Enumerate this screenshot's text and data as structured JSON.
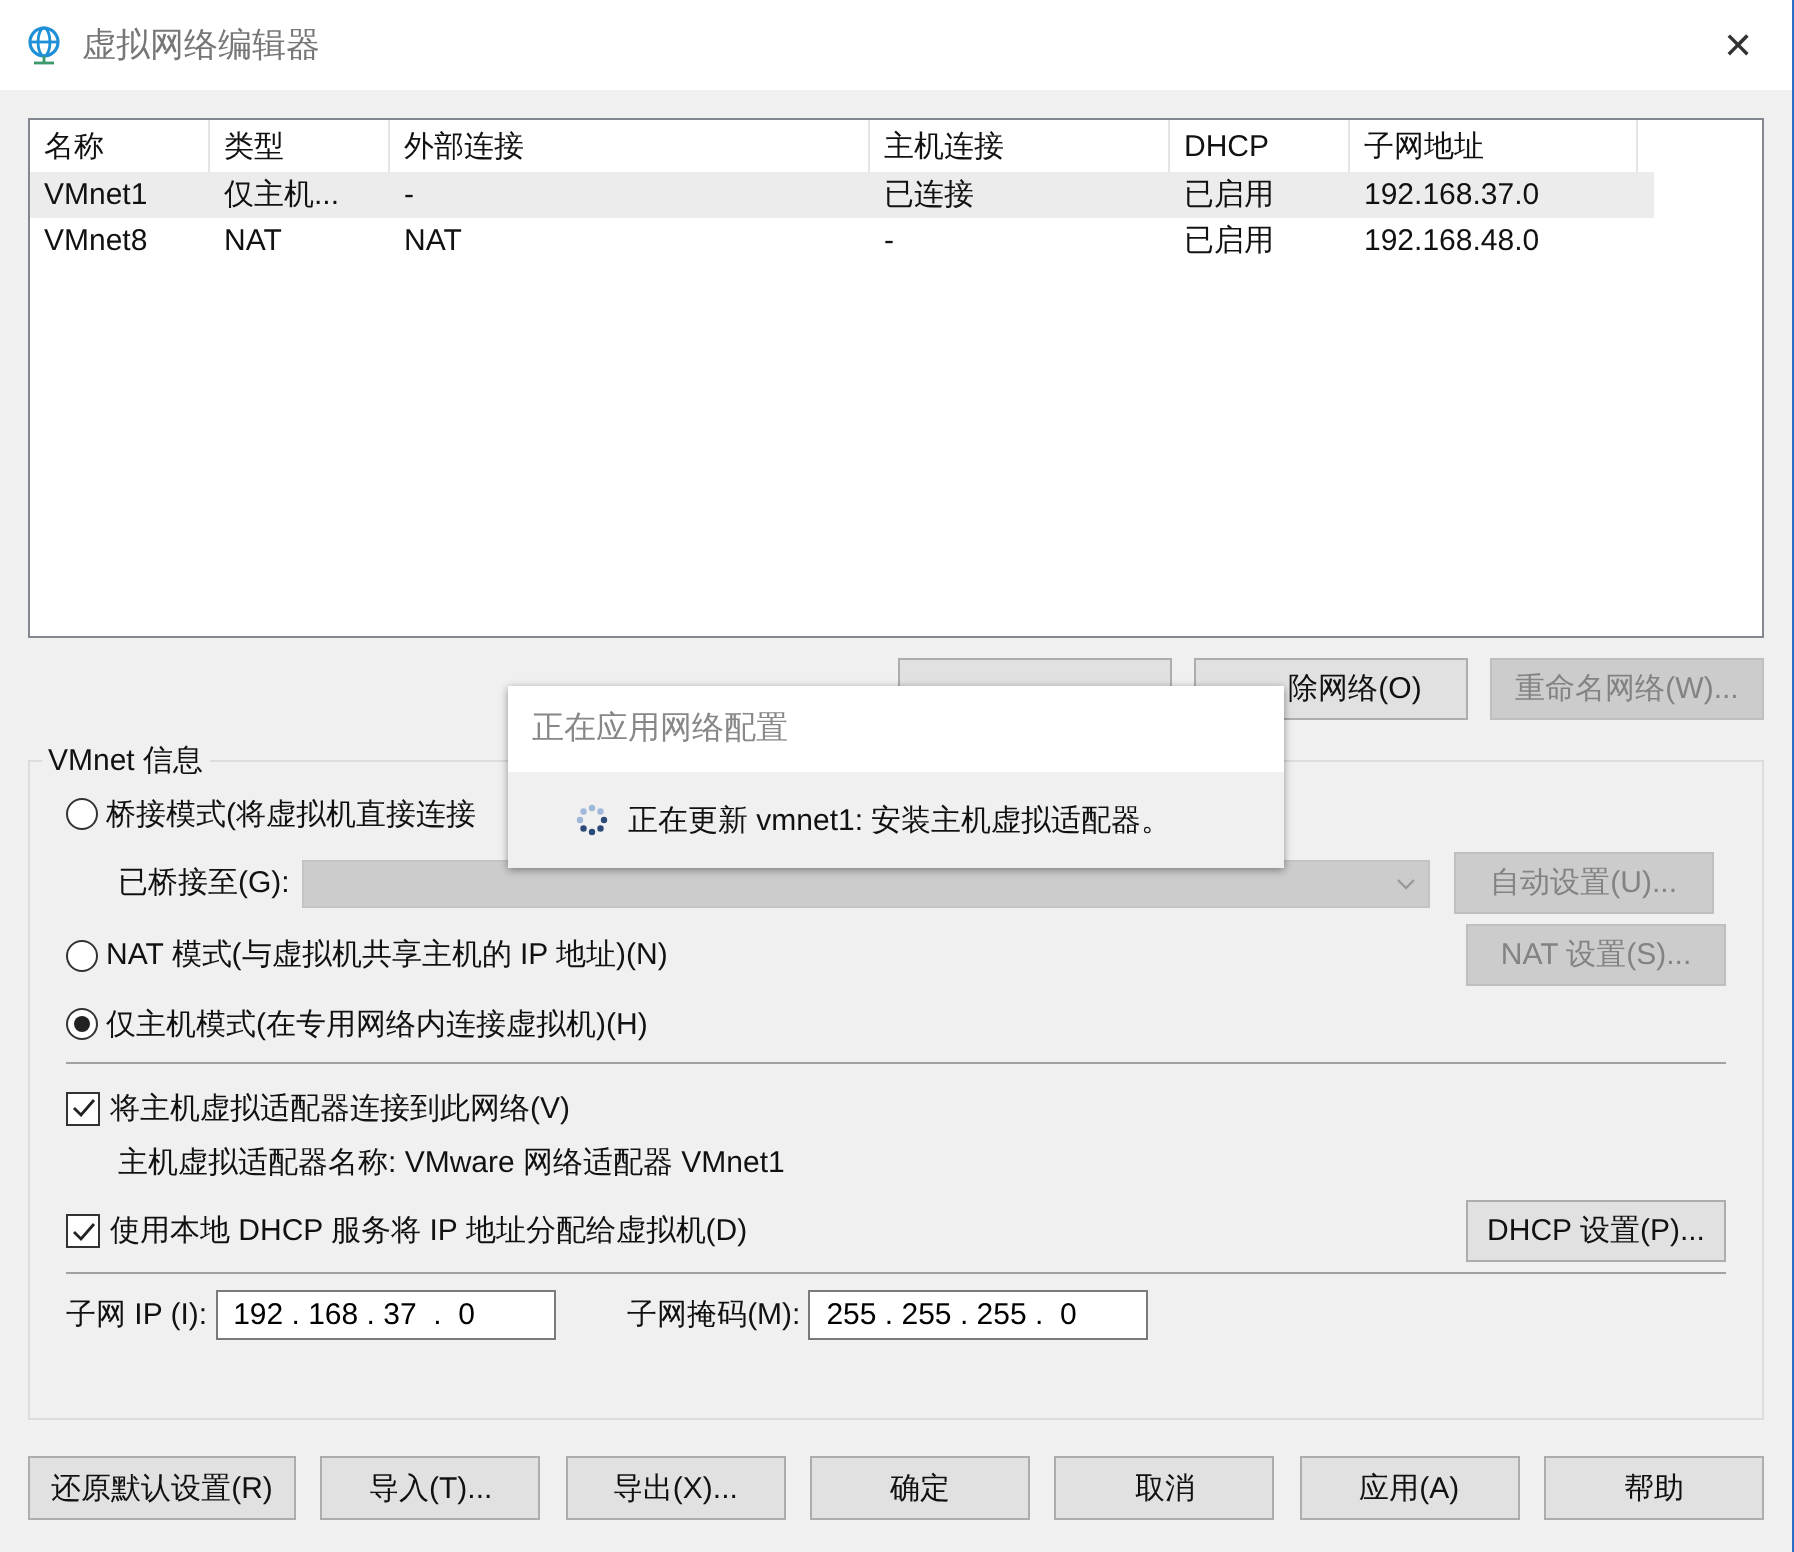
{
  "window": {
    "title": "虚拟网络编辑器",
    "close": "✕"
  },
  "table": {
    "columns": [
      "名称",
      "类型",
      "外部连接",
      "主机连接",
      "DHCP",
      "子网地址"
    ],
    "rows": [
      {
        "cells": [
          "VMnet1",
          "仅主机...",
          "-",
          "已连接",
          "已启用",
          "192.168.37.0"
        ],
        "selected": true
      },
      {
        "cells": [
          "VMnet8",
          "NAT",
          "NAT",
          "-",
          "已启用",
          "192.168.48.0"
        ],
        "selected": false
      }
    ]
  },
  "network_buttons": [
    {
      "disabled": false
    },
    {
      "label": "除网络(O)",
      "disabled": false
    },
    {
      "label": "重命名网络(W)...",
      "disabled": true
    }
  ],
  "group": {
    "title": "VMnet 信息",
    "modes": [
      {
        "label": "桥接模式(将虚拟机直接连接",
        "selected": false
      },
      {
        "label": "NAT 模式(与虚拟机共享主机的 IP 地址)(N)",
        "selected": false
      },
      {
        "label": "仅主机模式(在专用网络内连接虚拟机)(H)",
        "selected": true
      }
    ],
    "bridged_to": {
      "label": "已桥接至(G):",
      "disabled": true
    },
    "auto_button": {
      "label": "自动设置(U)...",
      "disabled": true
    },
    "nat_button": {
      "label": "NAT 设置(S)...",
      "disabled": true
    },
    "connect_adapter": {
      "label": "将主机虚拟适配器连接到此网络(V)",
      "checked": true
    },
    "adapter_name": "主机虚拟适配器名称: VMware 网络适配器 VMnet1",
    "use_dhcp": {
      "label": "使用本地 DHCP 服务将 IP 地址分配给虚拟机(D)",
      "checked": true
    },
    "dhcp_button": {
      "label": "DHCP 设置(P)...",
      "disabled": false
    },
    "subnet_ip": {
      "label": "子网 IP (I):",
      "value": "192 . 168 . 37  .  0"
    },
    "subnet_mask": {
      "label": "子网掩码(M):",
      "value": "255 . 255 . 255 .  0"
    }
  },
  "footer_buttons": [
    "还原默认设置(R)",
    "导入(T)...",
    "导出(X)...",
    "确定",
    "取消",
    "应用(A)",
    "帮助"
  ],
  "popup": {
    "title": "正在应用网络配置",
    "message": "正在更新 vmnet1: 安装主机虚拟适配器。"
  }
}
